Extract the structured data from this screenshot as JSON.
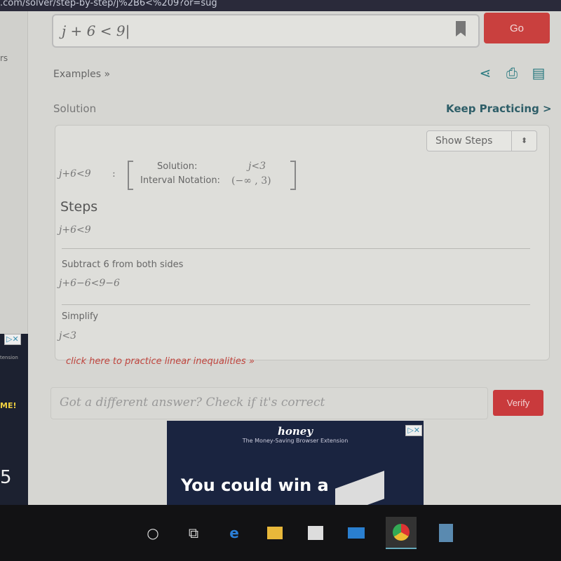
{
  "browser": {
    "url": ".com/solver/step-by-step/j%2B6<%209?or=sug"
  },
  "sidebar": {
    "partial_text": "rs",
    "ad_text": "tension",
    "ad_cta": "ME!",
    "ad_logo": "5"
  },
  "search": {
    "value": "j + 6 < 9",
    "go_label": "Go"
  },
  "toolbar": {
    "examples_link": "Examples »",
    "icons": [
      "share-icon",
      "print-icon",
      "pdf-icon"
    ]
  },
  "solution": {
    "label": "Solution",
    "keep_practicing": "Keep Practicing >",
    "show_steps_select": "Show Steps",
    "equation": "j+6<9",
    "colon": ":",
    "solution_label": "Solution:",
    "solution_value": "j<3",
    "interval_label": "Interval Notation:",
    "interval_value": "(−∞ , 3)"
  },
  "steps": {
    "heading": "Steps",
    "initial": "j+6<9",
    "items": [
      {
        "title": "Subtract 6 from both sides",
        "expr": "j+6−6<9−6"
      },
      {
        "title": "Simplify",
        "expr": "j<3"
      }
    ],
    "practice_link": "click here to practice linear inequalities »"
  },
  "check": {
    "placeholder": "Got a different answer? Check if it's correct",
    "verify_label": "Verify"
  },
  "ad": {
    "brand": "honey",
    "tagline": "The Money-Saving Browser Extension",
    "headline": "You could win a"
  },
  "taskbar": {
    "icons": [
      "cortana-icon",
      "task-view-icon",
      "edge-icon",
      "file-explorer-icon",
      "store-icon",
      "mail-icon",
      "chrome-icon",
      "calculator-icon"
    ]
  },
  "colors": {
    "accent": "#c9403e",
    "link": "#c0453e",
    "teal": "#2a7a80"
  }
}
